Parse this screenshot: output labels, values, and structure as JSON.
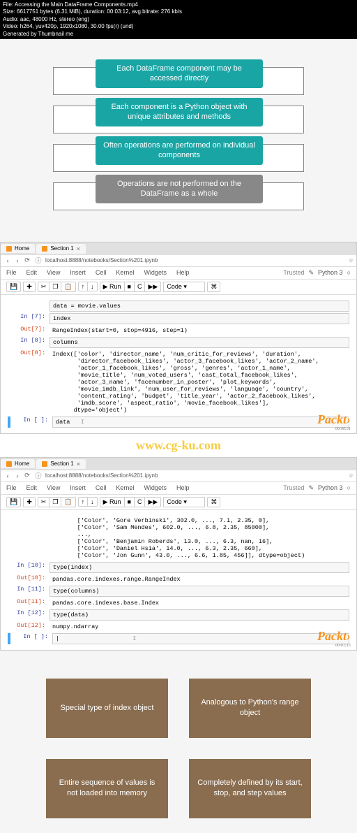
{
  "video_meta": {
    "file": "File: Accessing the Main DataFrame Components.mp4",
    "size": "Size: 6617751 bytes (6.31 MiB), duration: 00:03:12, avg.bitrate: 276 kb/s",
    "audio": "Audio: aac, 48000 Hz, stereo (eng)",
    "video": "Video: h264, yuv420p, 1920x1080, 30.00 fps(r) (und)",
    "gen": "Generated by Thumbnail me"
  },
  "slide1": {
    "callouts": [
      {
        "text": "Each DataFrame component may be accessed directly",
        "cls": "teal"
      },
      {
        "text": "Each component is a Python object with unique attributes and methods",
        "cls": "teal"
      },
      {
        "text": "Often operations are performed on individual components",
        "cls": "teal"
      },
      {
        "text": "Operations are not performed on the DataFrame as a whole",
        "cls": "gray"
      }
    ]
  },
  "browser": {
    "tab1": "Home",
    "tab2": "Section 1",
    "url": "localhost:8888/notebooks/Section%201.ipynb",
    "star": "☆"
  },
  "menu": {
    "items": [
      "File",
      "Edit",
      "View",
      "Insert",
      "Cell",
      "Kernel",
      "Widgets",
      "Help"
    ],
    "trusted": "Trusted",
    "kernel": "Python 3"
  },
  "toolbar": {
    "save": "💾",
    "add": "✚",
    "cut": "✂",
    "copy": "❐",
    "paste": "📋",
    "up": "↑",
    "down": "↓",
    "run": "▶ Run",
    "stop": "■",
    "restart": "C",
    "forward": "▶▶",
    "celltype": "Code",
    "cmd": "⌘"
  },
  "nb1": {
    "pre": "data = movie.values",
    "in7": "In [7]:",
    "in7_code": "index",
    "out7": "Out[7]:",
    "out7_text": "RangeIndex(start=0, stop=4916, step=1)",
    "in8": "In [8]:",
    "in8_code": "columns",
    "out8": "Out[8]:",
    "out8_text": "Index(['color', 'director_name', 'num_critic_for_reviews', 'duration',\n       'director_facebook_likes', 'actor_3_facebook_likes', 'actor_2_name',\n       'actor_1_facebook_likes', 'gross', 'genres', 'actor_1_name',\n       'movie_title', 'num_voted_users', 'cast_total_facebook_likes',\n       'actor_3_name', 'facenumber_in_poster', 'plot_keywords',\n       'movie_imdb_link', 'num_user_for_reviews', 'language', 'country',\n       'content_rating', 'budget', 'title_year', 'actor_2_facebook_likes',\n       'imdb_score', 'aspect_ratio', 'movie_facebook_likes'],\n      dtype='object')",
    "in_empty": "In [ ]:",
    "in_empty_code": "data"
  },
  "watermark": "www.cg-ku.com",
  "nb2": {
    "pre": "       ['Color', 'Gore Verbinski', 302.0, ..., 7.1, 2.35, 0],\n       ['Color', 'Sam Mendes', 602.0, ..., 6.8, 2.35, 85000],\n       ...,\n       ['Color', 'Benjamin Roberds', 13.0, ..., 6.3, nan, 16],\n       ['Color', 'Daniel Hsia', 14.0, ..., 6.3, 2.35, 660],\n       ['Color', 'Jon Gunn', 43.0, ..., 6.6, 1.85, 456]], dtype=object)",
    "in10": "In [10]:",
    "in10_code": "type(index)",
    "out10": "Out[10]:",
    "out10_text": "pandas.core.indexes.range.RangeIndex",
    "in11": "In [11]:",
    "in11_code": "type(columns)",
    "out11": "Out[11]:",
    "out11_text": "pandas.core.indexes.base.Index",
    "in12": "In [12]:",
    "in12_code": "type(data)",
    "out12": "Out[12]:",
    "out12_text": "numpy.ndarray",
    "in_empty": "In [ ]:",
    "cursor": "I"
  },
  "packt": {
    "brand": "Packt›",
    "time1": "00:00:51",
    "time2": "00:01:15"
  },
  "slide2": {
    "boxes": [
      "Special type of index object",
      "Analogous to Python's range object",
      "Entire sequence of values is not loaded into memory",
      "Completely defined by its start, stop, and step values"
    ]
  }
}
